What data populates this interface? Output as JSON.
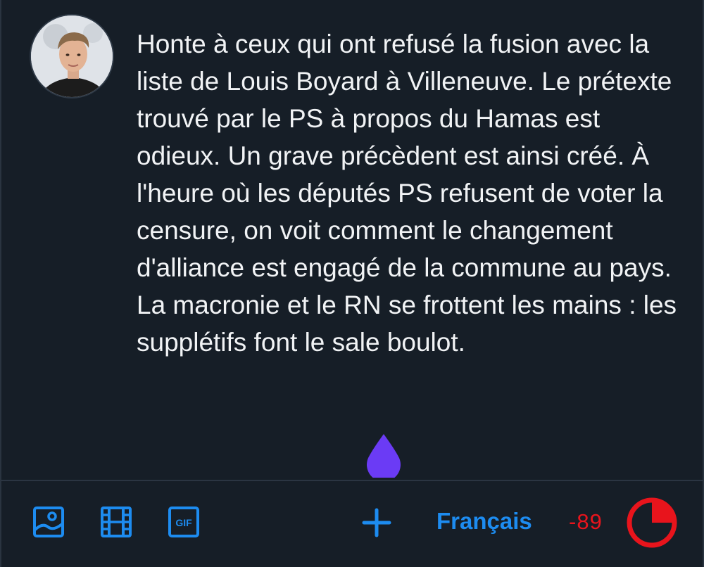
{
  "post": {
    "text": "Honte à ceux qui ont refusé la fusion avec la liste de Louis Boyard à Villeneuve. Le prétexte trouvé par le PS à propos du Hamas est odieux. Un grave précèdent est ainsi créé. À l'heure où les députés PS refusent de voter la censure, on voit comment le changement d'alliance est engagé de la commune au pays. La macronie et le RN se frottent les mains : les supplétifs font le sale boulot."
  },
  "toolbar": {
    "gif_label": "GIF",
    "language": "Français",
    "char_remaining": "-89",
    "char_limit_exceeded": true
  },
  "colors": {
    "background": "#161e27",
    "accent": "#1d8cf0",
    "cursor": "#6b3bf5",
    "over_limit": "#e8141c"
  },
  "icons": [
    "image-icon",
    "video-icon",
    "gif-icon",
    "add-icon",
    "char-limit-ring-icon"
  ]
}
